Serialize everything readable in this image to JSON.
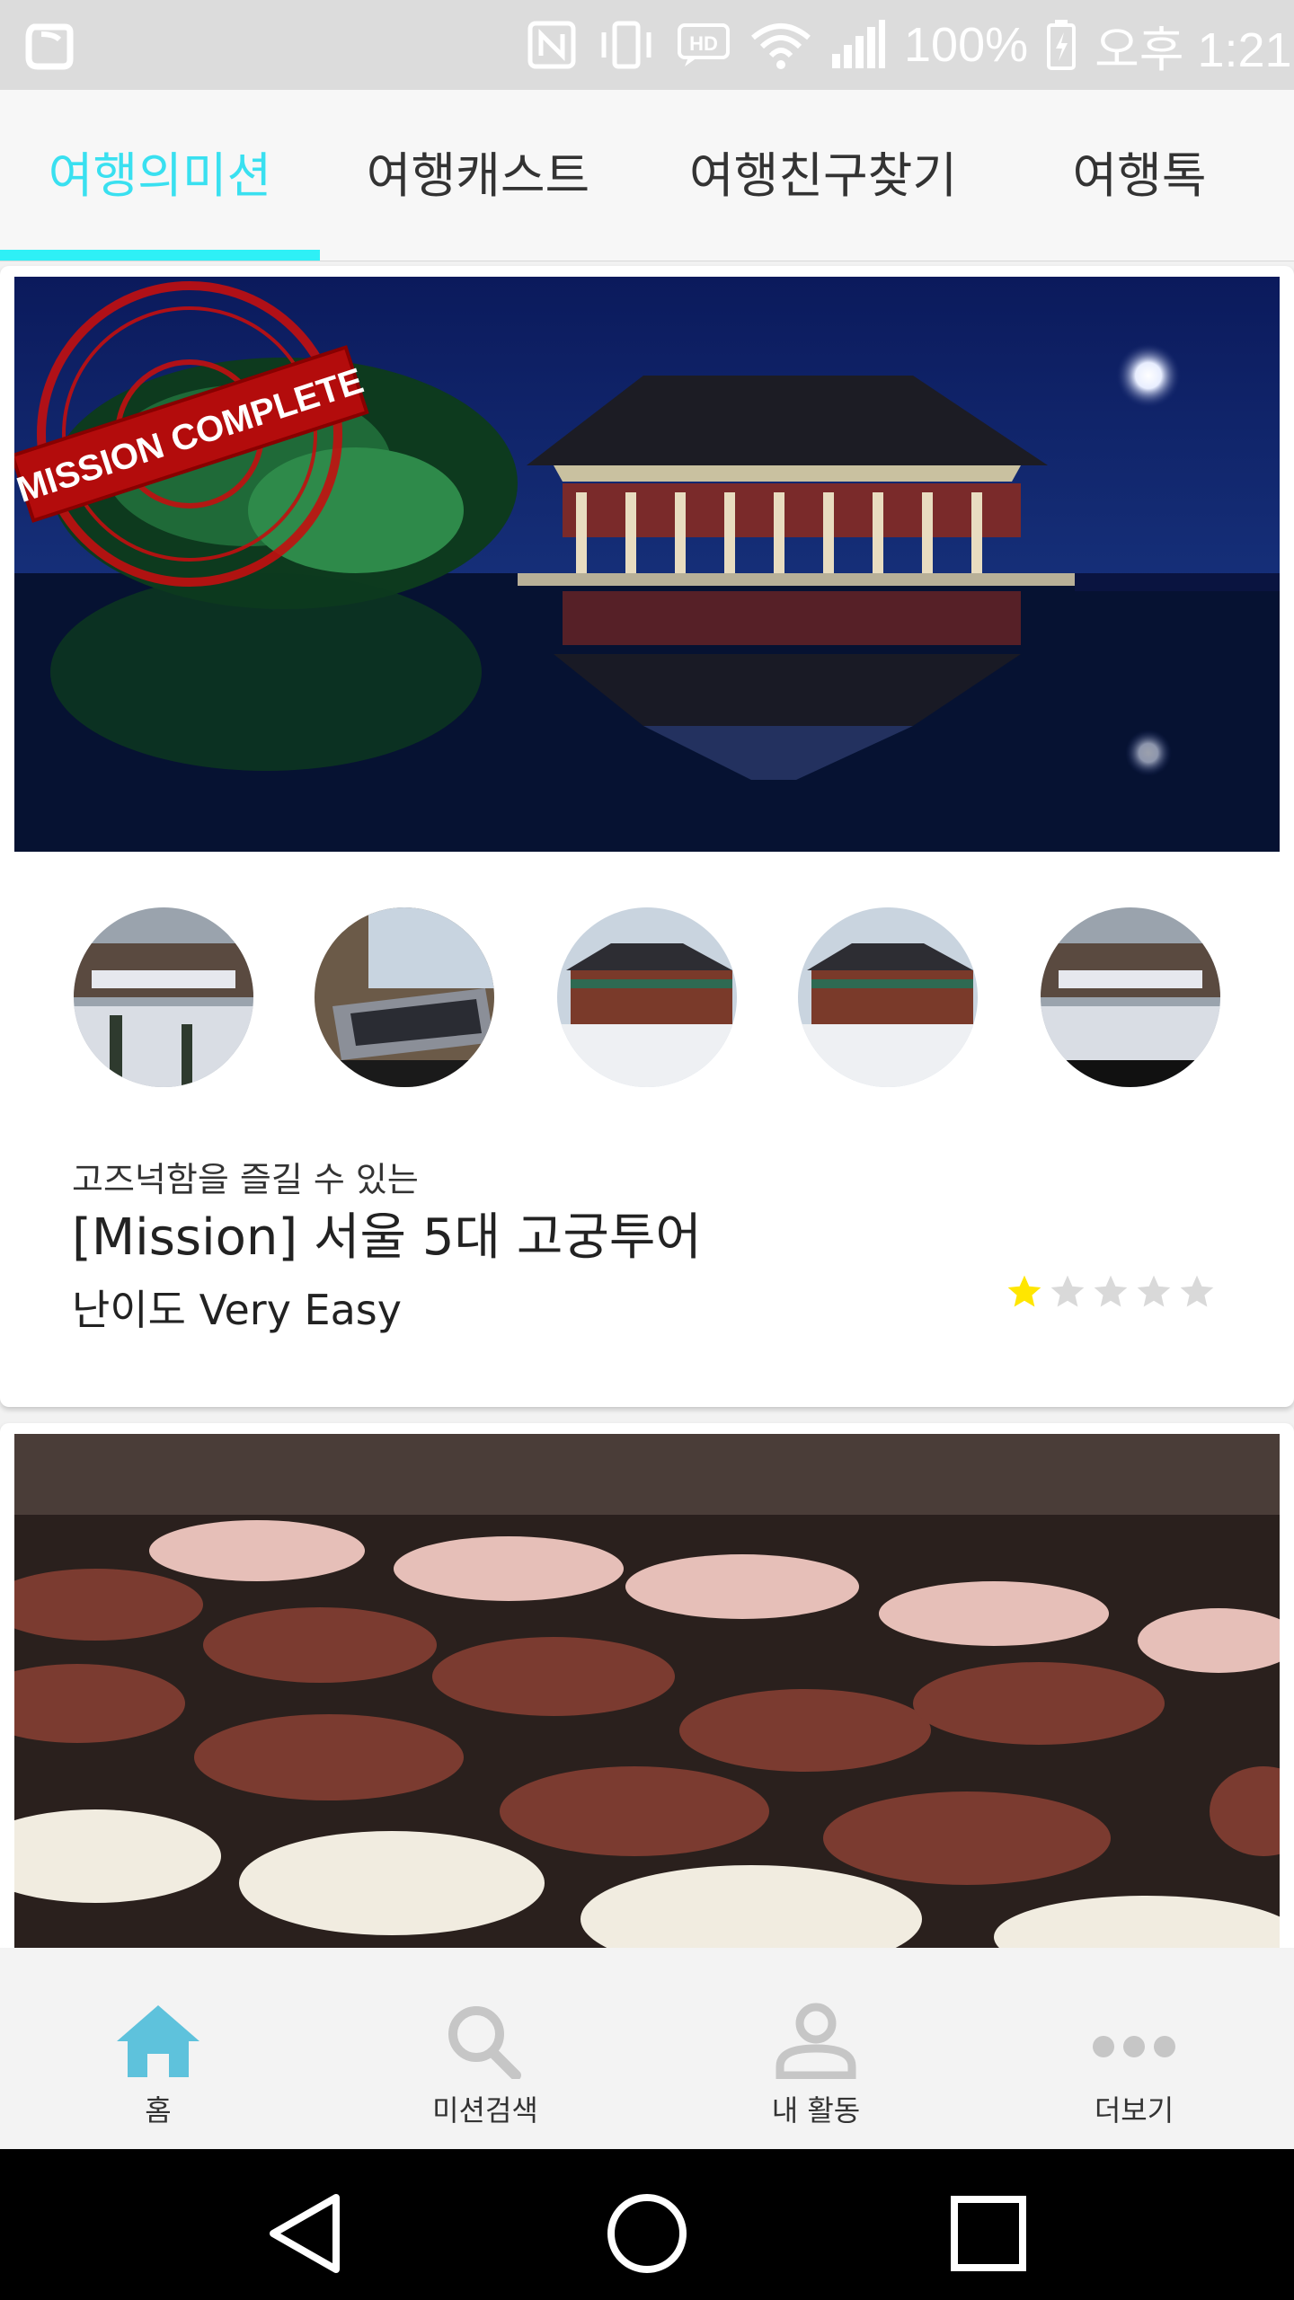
{
  "status_bar": {
    "battery_percent": "100%",
    "time": "오후 1:21",
    "icons": [
      "nfc-icon",
      "vibrate-icon",
      "hd-voice-icon",
      "wifi-icon",
      "signal-icon",
      "battery-charging-icon"
    ]
  },
  "tabs": [
    {
      "label": "여행의미션",
      "active": true
    },
    {
      "label": "여행캐스트",
      "active": false
    },
    {
      "label": "여행친구찾기",
      "active": false
    },
    {
      "label": "여행톡",
      "active": false
    }
  ],
  "accent_color": "#2ef0f6",
  "mission_card": {
    "stamp_text": "MISSION COMPLETE",
    "subtitle": "고즈넉함을 즐길 수 있는",
    "title": "[Mission] 서울 5대 고궁투어",
    "difficulty": "난이도 Very Easy",
    "rating": 1,
    "rating_max": 5,
    "thumbnails": [
      "palace-snow-aerial",
      "laptop-desk",
      "palace-building",
      "palace-building",
      "palace-snow-aerial"
    ]
  },
  "bottom_nav": [
    {
      "label": "홈",
      "icon": "home-icon",
      "active": true
    },
    {
      "label": "미션검색",
      "icon": "search-icon",
      "active": false
    },
    {
      "label": "내 활동",
      "icon": "person-icon",
      "active": false
    },
    {
      "label": "더보기",
      "icon": "more-dots-icon",
      "active": false
    }
  ],
  "system_nav": [
    "back-icon",
    "home-circle-icon",
    "recents-icon"
  ]
}
